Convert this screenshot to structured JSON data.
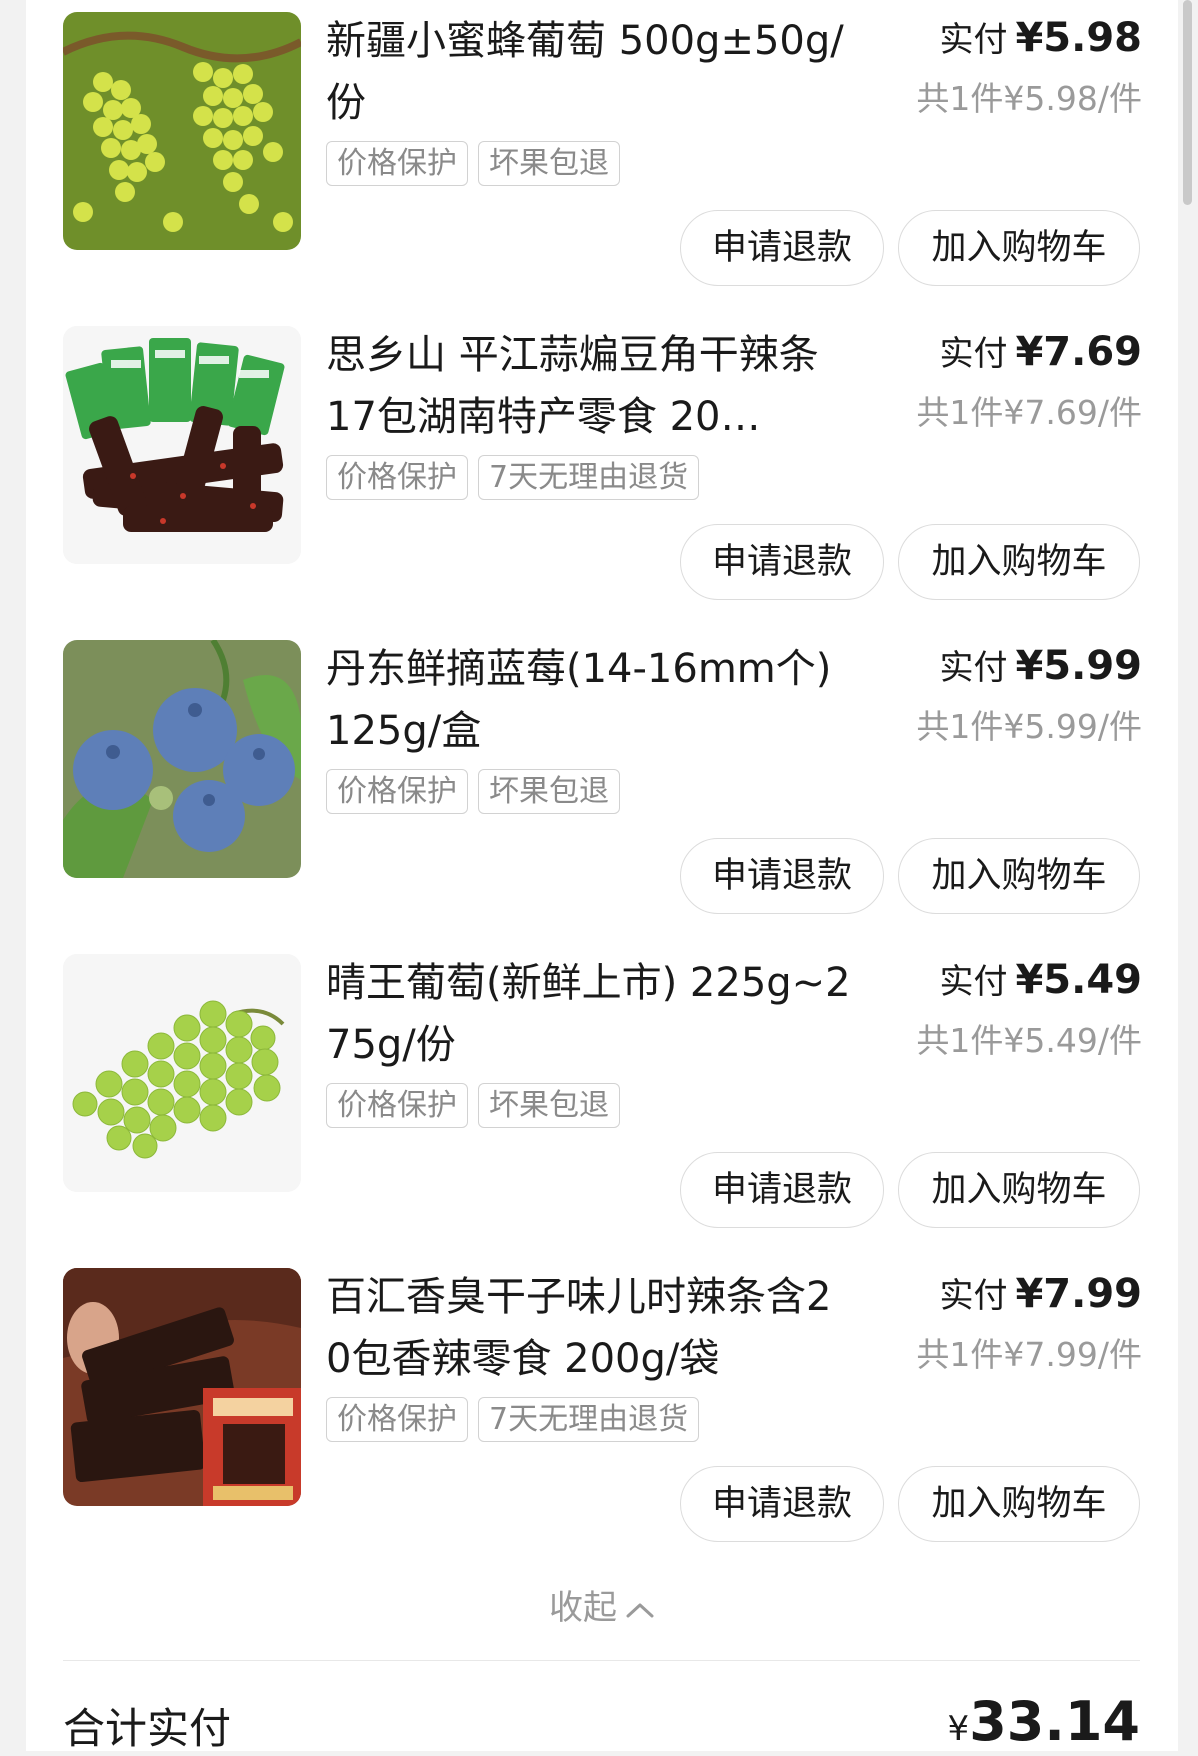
{
  "items": [
    {
      "title": "新疆小蜜蜂葡萄 500g±50g/份",
      "tags": [
        "价格保护",
        "坏果包退"
      ],
      "pay_label": "实付",
      "pay_amount": "¥5.98",
      "unit_price": "共1件¥5.98/件",
      "refund_label": "申请退款",
      "cart_label": "加入购物车",
      "image_icon": "green-grapes-photo"
    },
    {
      "title": "思乡山 平江蒜煸豆角干辣条 17包湖南特产零食 20…",
      "tags": [
        "价格保护",
        "7天无理由退货"
      ],
      "pay_label": "实付",
      "pay_amount": "¥7.69",
      "unit_price": "共1件¥7.69/件",
      "refund_label": "申请退款",
      "cart_label": "加入购物车",
      "image_icon": "spicy-bean-snack-photo"
    },
    {
      "title": "丹东鲜摘蓝莓(14-16mm个)125g/盒",
      "tags": [
        "价格保护",
        "坏果包退"
      ],
      "pay_label": "实付",
      "pay_amount": "¥5.99",
      "unit_price": "共1件¥5.99/件",
      "refund_label": "申请退款",
      "cart_label": "加入购物车",
      "image_icon": "blueberries-photo"
    },
    {
      "title": "晴王葡萄(新鲜上市) 225g~275g/份",
      "tags": [
        "价格保护",
        "坏果包退"
      ],
      "pay_label": "实付",
      "pay_amount": "¥5.49",
      "unit_price": "共1件¥5.49/件",
      "refund_label": "申请退款",
      "cart_label": "加入购物车",
      "image_icon": "shine-muscat-grapes-photo"
    },
    {
      "title": "百汇香臭干子味儿时辣条含20包香辣零食 200g/袋",
      "tags": [
        "价格保护",
        "7天无理由退货"
      ],
      "pay_label": "实付",
      "pay_amount": "¥7.99",
      "unit_price": "共1件¥7.99/件",
      "refund_label": "申请退款",
      "cart_label": "加入购物车",
      "image_icon": "spicy-tofu-snack-photo"
    }
  ],
  "collapse_label": "收起",
  "total": {
    "label": "合计实付",
    "currency": "¥",
    "amount": "33.14"
  },
  "colors": {
    "background": "#f2f2f2",
    "card": "#ffffff",
    "muted_text": "#9a9a9a",
    "tag_border": "#d2d2d2"
  }
}
